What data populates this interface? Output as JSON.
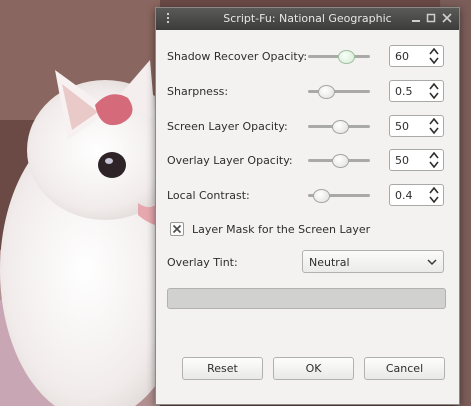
{
  "window": {
    "title": "Script-Fu: National Geographic"
  },
  "fields": [
    {
      "label": "Shadow Recover Opacity:",
      "value": "60",
      "slider_fraction": 0.6
    },
    {
      "label": "Sharpness:",
      "value": "0.5",
      "slider_fraction": 0.27
    },
    {
      "label": "Screen Layer Opacity:",
      "value": "50",
      "slider_fraction": 0.5
    },
    {
      "label": "Overlay Layer Opacity:",
      "value": "50",
      "slider_fraction": 0.5
    },
    {
      "label": "Local Contrast:",
      "value": "0.4",
      "slider_fraction": 0.2
    }
  ],
  "layer_mask": {
    "label": "Layer Mask for the Screen Layer",
    "checked": true
  },
  "overlay_tint": {
    "label": "Overlay Tint:",
    "selected": "Neutral"
  },
  "progress": {
    "fraction": 0
  },
  "buttons": {
    "reset": "Reset",
    "ok": "OK",
    "cancel": "Cancel"
  },
  "icons": {
    "window_menu": "window-menu-icon",
    "minimize": "minimize-icon",
    "maximize": "maximize-icon",
    "close": "close-icon",
    "spin_arrows": "spin-arrows-icon",
    "checkbox": "checkbox-icon",
    "select_chevron": "chevron-down-icon"
  },
  "colors": {
    "dialog_bg": "#f3f2f1",
    "titlebar": "#4a4a48",
    "active_knob": "#d6ead8"
  }
}
